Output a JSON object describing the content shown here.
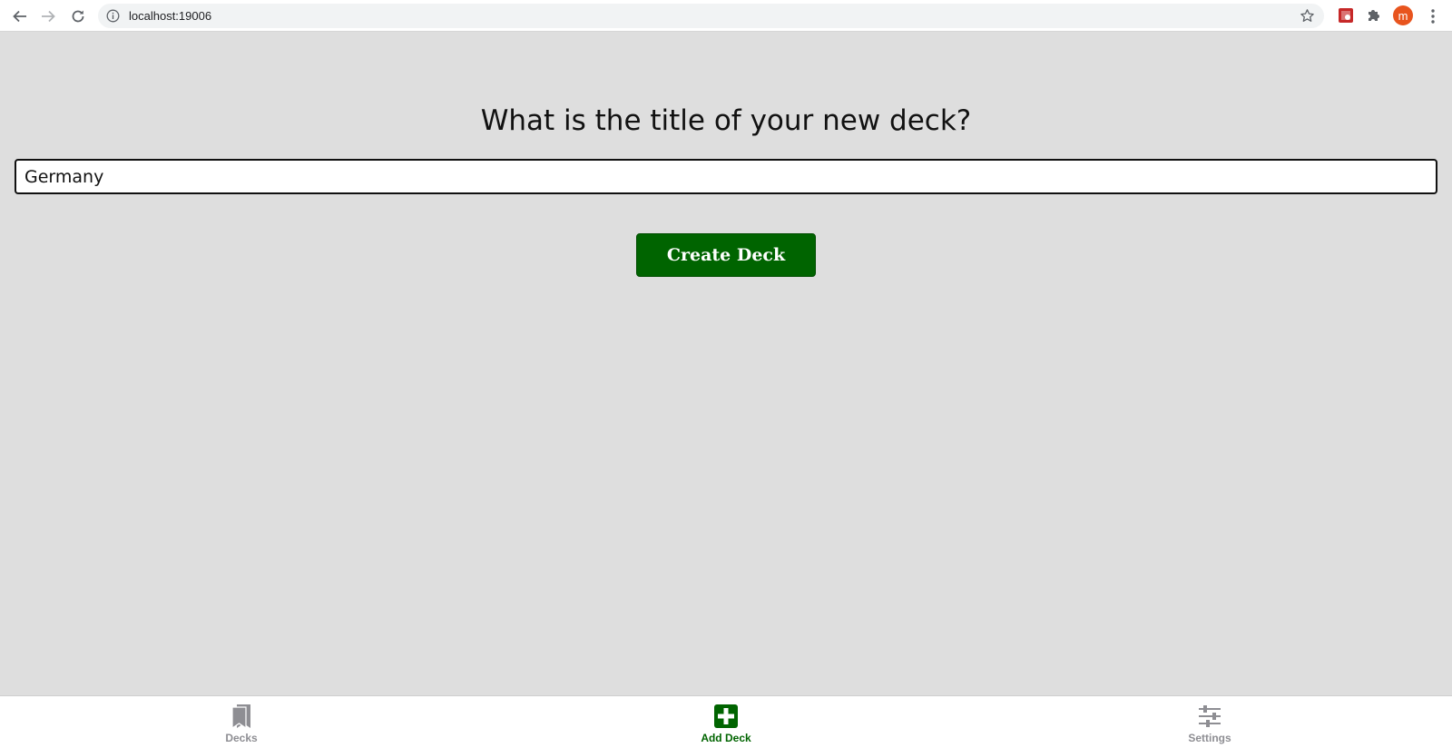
{
  "browser": {
    "url": "localhost:19006",
    "profile_initial": "m",
    "icons": {
      "back": "arrow-left-icon",
      "forward": "arrow-right-icon",
      "reload": "reload-icon",
      "info": "info-icon",
      "bookmark": "star-icon",
      "extensions": "puzzle-icon",
      "menu": "kebab-icon"
    }
  },
  "form": {
    "title": "What is the title of your new deck?",
    "input_value": "Germany",
    "submit_label": "Create Deck"
  },
  "tabs": [
    {
      "label": "Decks",
      "icon": "bookmarks-icon",
      "active": false
    },
    {
      "label": "Add Deck",
      "icon": "plus-square-icon",
      "active": true
    },
    {
      "label": "Settings",
      "icon": "sliders-icon",
      "active": false
    }
  ],
  "colors": {
    "accent": "#006400",
    "background": "#dedede",
    "inactive_tab": "#8e8e93",
    "avatar": "#e8541e"
  }
}
